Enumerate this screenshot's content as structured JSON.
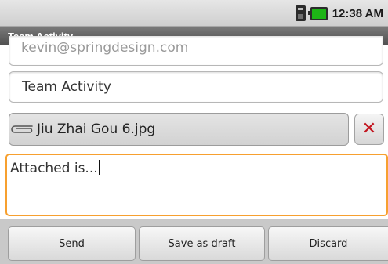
{
  "status_bar": {
    "time": "12:38 AM",
    "icons": [
      "sim-card-icon",
      "battery-icon"
    ]
  },
  "title_bar": {
    "title": "Team Activity"
  },
  "compose": {
    "to_value": "kevin@springdesign.com",
    "subject_value": "Team Activity",
    "attachment": {
      "icon": "paperclip-icon",
      "filename": "Jiu Zhai Gou 6.jpg",
      "remove_icon": "close-x-icon"
    },
    "body_value": "Attached is..."
  },
  "buttons": {
    "send": "Send",
    "save_draft": "Save as draft",
    "discard": "Discard"
  },
  "colors": {
    "focus_border": "#f7a02f",
    "remove_x": "#c2141e",
    "battery": "#1db416"
  }
}
